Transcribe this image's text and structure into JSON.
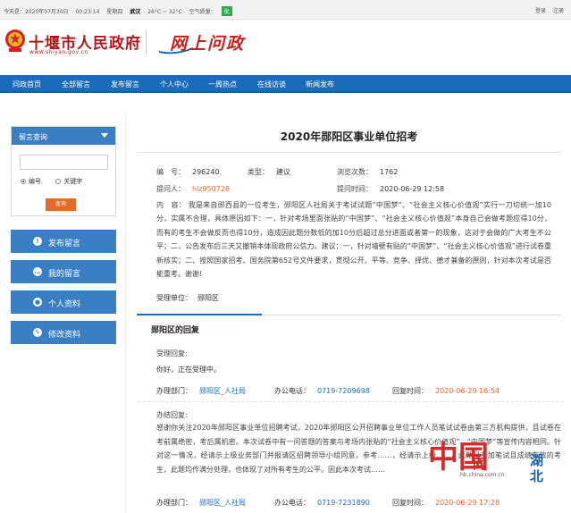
{
  "topbar": {
    "date": "今天是：2020年07月30日",
    "time": "00:23:14",
    "weekday": "星期四",
    "city": "武汉",
    "temperature": "26°C ~ 32°C",
    "air_quality_label": "空气质量：",
    "air_quality_value": "优",
    "login": "登录",
    "register": "注册"
  },
  "header": {
    "site_name": "十堰市人民政府",
    "site_url": "www.shiyan.gov.cn",
    "wenzheng_logo": "网上问政",
    "brand_color": "#b2161c"
  },
  "nav": {
    "items": [
      "问政首页",
      "全部留言",
      "发布留言",
      "个人中心",
      "一周热点",
      "在线访谈",
      "新闻发布"
    ],
    "color": "#1a6cba"
  },
  "sidebar": {
    "query_title": "留言查询",
    "search_placeholder": "",
    "radio_number": "编号",
    "radio_keyword": "关键字",
    "query_button": "查询",
    "buttons": [
      {
        "label": "发布留言",
        "icon": "info-icon"
      },
      {
        "label": "我的留言",
        "icon": "chat-icon"
      },
      {
        "label": "个人资料",
        "icon": "user-icon"
      },
      {
        "label": "修改资料",
        "icon": "pencil-icon"
      }
    ]
  },
  "post": {
    "title": "2020年郧阳区事业单位招考",
    "number_label": "编　号：",
    "number": "296240",
    "type_label": "类型：",
    "type": "建议",
    "views_label": "浏览次数：",
    "views": "1762",
    "author_label": "提问人：",
    "author": "hlz950728",
    "time_label": "提问时间：",
    "time": "2020-06-29 12:58",
    "content_label": "内　容：",
    "content": "我是来自郧西县的一位考生，郧阳区人社局关于考试试题“中国梦”、“社会主义核心价值观”实行一刀切统一加10分，实属不合理，具体原因如下：一，针对考场里面张贴的“中国梦”、“社会主义核心价值观”本身自己会做考题应得10分，而有的考生不会做反而也得10分，造成因此题分数低的加10分后超过总分进面或者第一的现象，这对于会做的广大考生不公平；二，公告发布后三天又撤销本体现政府公信力。建议：一，针对墙壁有贴的“中国梦”、“社会主义核心价值观”进行试卷重新核实；二、按照国家招考、国务院第652号文件要求，贯彻公开、平等、竞争、择优、德才兼备的原则，针对本次考试是否能重考。谢谢!",
    "unit_label": "受理单位：",
    "unit": "郧阳区"
  },
  "reply": {
    "section_title": "郧阳区的回复",
    "accept_label": "受理回复:",
    "accept_text": "你好，正在受理中。",
    "accept_dept_label": "办理部门：",
    "accept_dept": "郧阳区_人社局",
    "accept_phone_label": "办公电话：",
    "accept_phone": "0719-7209698",
    "accept_time_label": "回复时间：",
    "accept_time": "2020-06-29 16:54",
    "done_label": "办结回复:",
    "done_text": "感谢你关注2020年郧阳区事业单位招聘考试，2020年郧阳区公开招聘事业单位工作人员笔试试卷由第三方机构提供，且试卷在考前属绝密，考后属机密。本次试卷中有一问答题的答案与考场内张贴的“社会主义核心价值观”、“中国梦”等宣传内容相同。针对这一情况，经请示上级业务部门并报请区招聘领导小组同意，参考……，经请示上级……，此题已参加笔试且成绩有效的考生，此题均作满分处理，也体现了对所有考生的公平。因此本次考试……",
    "done_dept_label": "办理部门：",
    "done_dept": "郧阳区_人社局",
    "done_phone_label": "办公电话：",
    "done_phone": "0719-7231890",
    "done_time_label": "回复时间：",
    "done_time": "2020-06-29 17:28"
  },
  "watermark": {
    "china": "中国",
    "wang": "网",
    "hubei_1": "湖",
    "hubei_2": "北",
    "url": "hb.china.com.cn"
  }
}
